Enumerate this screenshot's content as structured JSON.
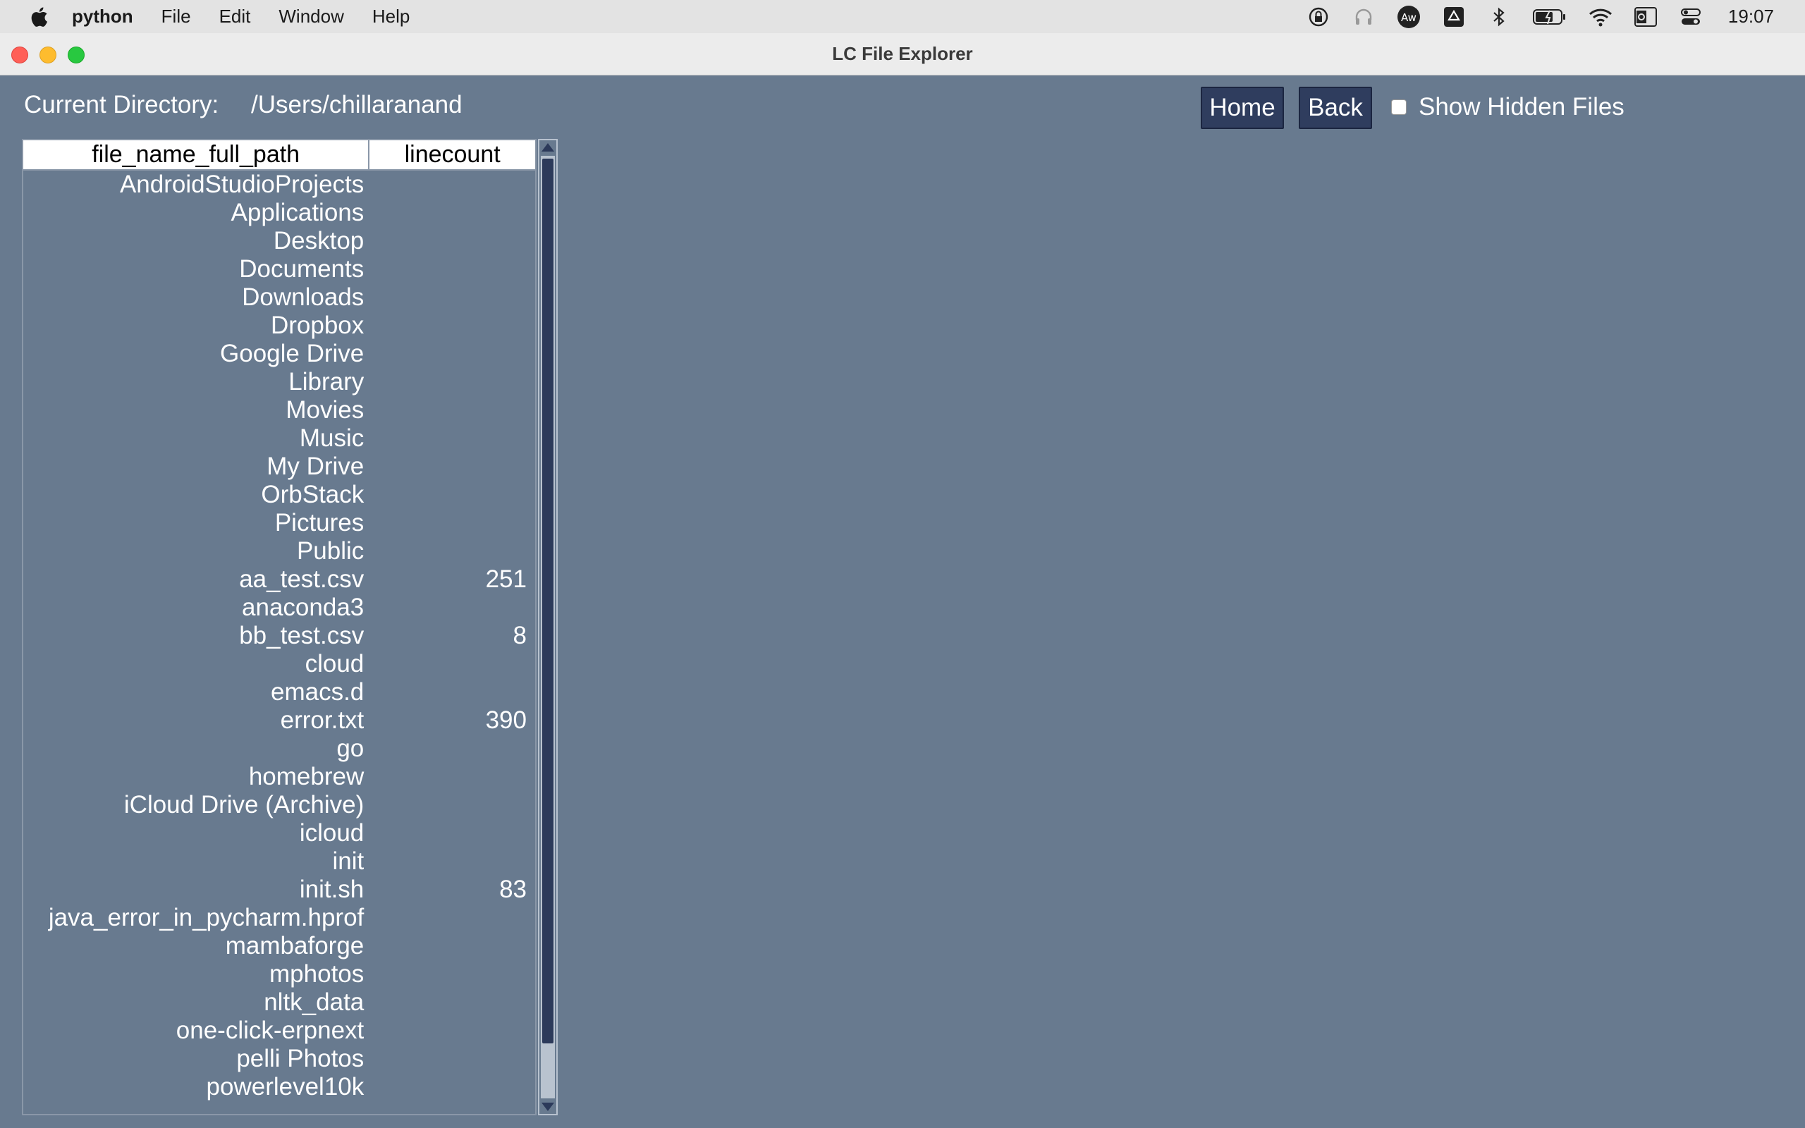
{
  "menubar": {
    "app_name": "python",
    "items": [
      "File",
      "Edit",
      "Window",
      "Help"
    ],
    "clock": "19:07",
    "status_icons": [
      "screen-lock-icon",
      "headphones-icon",
      "adobe-acrobat-icon",
      "google-drive-icon",
      "bluetooth-icon",
      "battery-icon",
      "wifi-icon",
      "outlook-icon",
      "control-center-icon"
    ]
  },
  "window": {
    "title": "LC File Explorer"
  },
  "explorer": {
    "current_dir_label": "Current Directory:",
    "current_dir": "/Users/chillaranand",
    "home_label": "Home",
    "back_label": "Back",
    "show_hidden_label": "Show Hidden Files",
    "show_hidden_checked": false
  },
  "table": {
    "columns": [
      "file_name_full_path",
      "linecount"
    ],
    "rows": [
      {
        "name": "AndroidStudioProjects",
        "count": ""
      },
      {
        "name": "Applications",
        "count": ""
      },
      {
        "name": "Desktop",
        "count": ""
      },
      {
        "name": "Documents",
        "count": ""
      },
      {
        "name": "Downloads",
        "count": ""
      },
      {
        "name": "Dropbox",
        "count": ""
      },
      {
        "name": "Google Drive",
        "count": ""
      },
      {
        "name": "Library",
        "count": ""
      },
      {
        "name": "Movies",
        "count": ""
      },
      {
        "name": "Music",
        "count": ""
      },
      {
        "name": "My Drive",
        "count": ""
      },
      {
        "name": "OrbStack",
        "count": ""
      },
      {
        "name": "Pictures",
        "count": ""
      },
      {
        "name": "Public",
        "count": ""
      },
      {
        "name": "aa_test.csv",
        "count": "251"
      },
      {
        "name": "anaconda3",
        "count": ""
      },
      {
        "name": "bb_test.csv",
        "count": "8"
      },
      {
        "name": "cloud",
        "count": ""
      },
      {
        "name": "emacs.d",
        "count": ""
      },
      {
        "name": "error.txt",
        "count": "390"
      },
      {
        "name": "go",
        "count": ""
      },
      {
        "name": "homebrew",
        "count": ""
      },
      {
        "name": "iCloud Drive (Archive)",
        "count": ""
      },
      {
        "name": "icloud",
        "count": ""
      },
      {
        "name": "init",
        "count": ""
      },
      {
        "name": "init.sh",
        "count": "83"
      },
      {
        "name": "java_error_in_pycharm.hprof",
        "count": ""
      },
      {
        "name": "mambaforge",
        "count": ""
      },
      {
        "name": "mphotos",
        "count": ""
      },
      {
        "name": "nltk_data",
        "count": ""
      },
      {
        "name": "one-click-erpnext",
        "count": ""
      },
      {
        "name": "pelli Photos",
        "count": ""
      },
      {
        "name": "powerlevel10k",
        "count": ""
      }
    ]
  }
}
